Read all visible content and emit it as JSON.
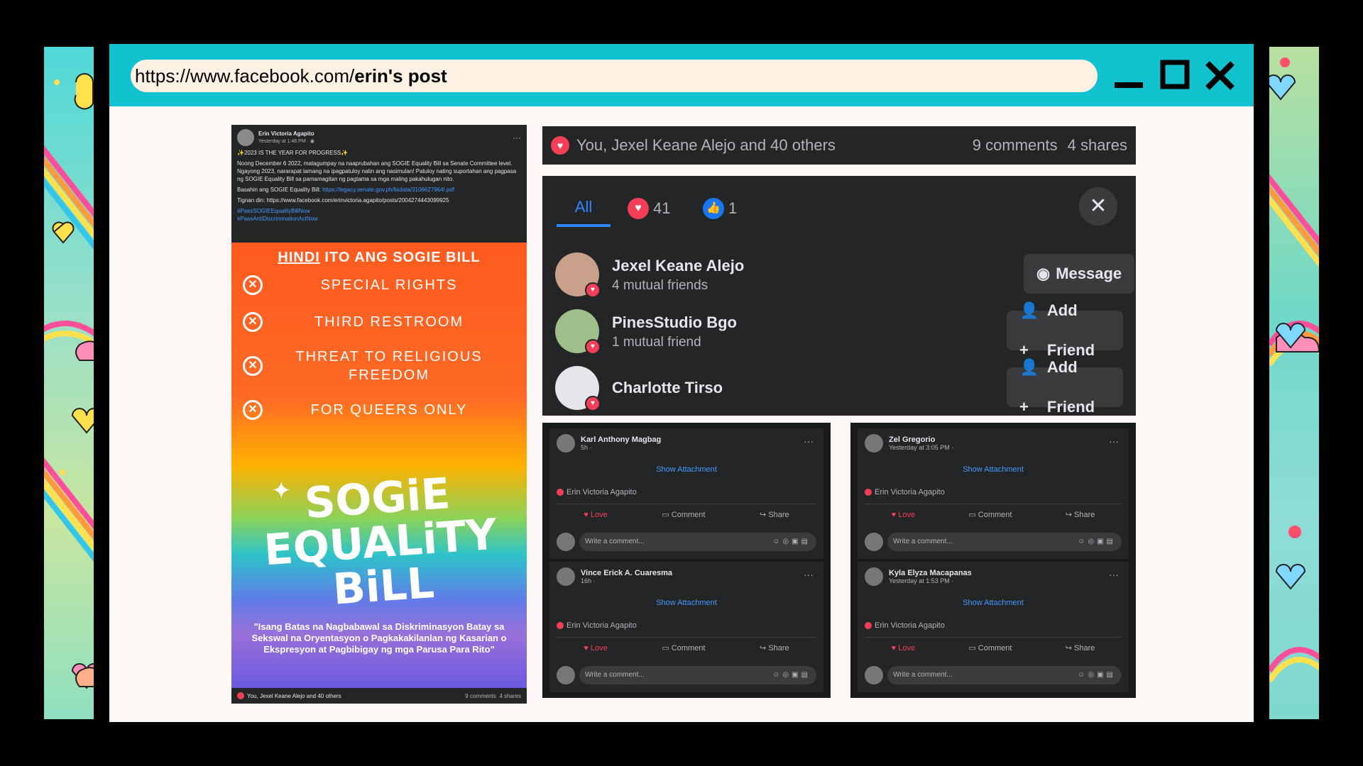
{
  "browser": {
    "url_prefix": "https://www.facebook.com/",
    "url_bold": "erin's post"
  },
  "post": {
    "author": "Erin Victoria Agapito",
    "time": "Yesterday at 1:46 PM · ",
    "headline": "✨2023 IS THE YEAR FOR PROGRESS✨",
    "body": "Noong December 6 2022, matagumpay na naaprubahan ang SOGIE Equality Bill sa Senate Committee level. Ngayong 2023, nararapat lamang na ipagpatuloy natin ang nasimulan! Patuloy nating suportahan ang pagpasa ng SOGIE Equality Bill sa pamamagitan ng pagtama sa mga maling pakahulugan nito.",
    "read_label": "Basahin ang SOGIE Equality Bill: ",
    "read_link": "https://legacy.senate.gov.ph/lisdata/3106627964!.pdf",
    "see_also": "Tignan din: https://www.facebook.com/erinvictoria.agapito/posts/2004274443099925",
    "hashtag1": "#PassSOGIEEqualityBillNow",
    "hashtag2": "#PassAntiDiscriminationActNow",
    "poster_title_u": "HINDI",
    "poster_title_rest": " ITO ANG SOGIE BILL",
    "myths": [
      "SPECIAL RIGHTS",
      "THIRD RESTROOM",
      "THREAT TO RELIGIOUS FREEDOM",
      "FOR QUEERS ONLY"
    ],
    "big_title": "SOGiE EQUALiTY BiLL",
    "quote": "\"Isang Batas na Nagbabawal sa Diskriminasyon Batay sa Sekswal na Oryentasyon o Pagkakakilanlan ng Kasarian o Ekspresyon at Pagbibigay ng mga Parusa Para Rito\"",
    "footer_reactions": "You, Jexel Keane Alejo and 40 others",
    "footer_comments": "9 comments",
    "footer_shares": "4 shares"
  },
  "summary": {
    "reactions": "You, Jexel Keane Alejo and 40 others",
    "comments": "9 comments",
    "shares": "4 shares"
  },
  "reactions_dialog": {
    "tab_all": "All",
    "love_count": "41",
    "like_count": "1",
    "people": [
      {
        "name": "Jexel Keane Alejo",
        "sub": "4 mutual friends",
        "button": "Message",
        "button_icon": "messenger-icon"
      },
      {
        "name": "PinesStudio Bgo",
        "sub": "1 mutual friend",
        "button": "Add Friend",
        "button_icon": "add-friend-icon"
      },
      {
        "name": "Charlotte Tirso",
        "sub": "",
        "button": "Add Friend",
        "button_icon": "add-friend-icon"
      }
    ]
  },
  "comments": [
    {
      "name": "Karl Anthony Magbag",
      "time": "5h · ",
      "attach": "Show Attachment",
      "liker": "Erin Victoria Agapito",
      "love": "Love",
      "comment": "Comment",
      "share": "Share",
      "placeholder": "Write a comment..."
    },
    {
      "name": "Vince Erick A. Cuaresma",
      "time": "16h · ",
      "attach": "Show Attachment",
      "liker": "Erin Victoria Agapito",
      "love": "Love",
      "comment": "Comment",
      "share": "Share",
      "placeholder": "Write a comment..."
    },
    {
      "name": "Zel Gregorio",
      "time": "Yesterday at 3:05 PM · ",
      "attach": "Show Attachment",
      "liker": "Erin Victoria Agapito",
      "love": "Love",
      "comment": "Comment",
      "share": "Share",
      "placeholder": "Write a comment..."
    },
    {
      "name": "Kyla Elyza Macapanas",
      "time": "Yesterday at 1:53 PM · ",
      "attach": "Show Attachment",
      "liker": "Erin Victoria Agapito",
      "love": "Love",
      "comment": "Comment",
      "share": "Share",
      "placeholder": "Write a comment..."
    }
  ],
  "colors": {
    "titlebar": "#12c3cf",
    "fb_dark": "#242526",
    "love": "#f33e58",
    "link": "#4599ff"
  }
}
